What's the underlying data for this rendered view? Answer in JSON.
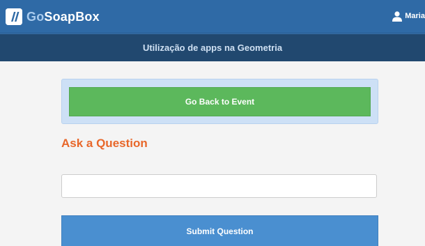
{
  "header": {
    "logo_prefix": "Go",
    "logo_suffix": "SoapBox",
    "user_name": "Maria"
  },
  "event": {
    "title": "Utilização de apps na Geometria"
  },
  "actions": {
    "back_label": "Go Back to Event"
  },
  "question_form": {
    "heading": "Ask a Question",
    "input_value": "",
    "input_placeholder": "",
    "submit_label": "Submit Question"
  },
  "colors": {
    "header_bg": "#2f6aa6",
    "subheader_bg": "#21486f",
    "back_button": "#5cb85c",
    "heading": "#e8672a",
    "submit_button": "#4a8fd0"
  },
  "icons": {
    "logo": "gosoapbox-logo-icon",
    "user": "user-icon"
  }
}
